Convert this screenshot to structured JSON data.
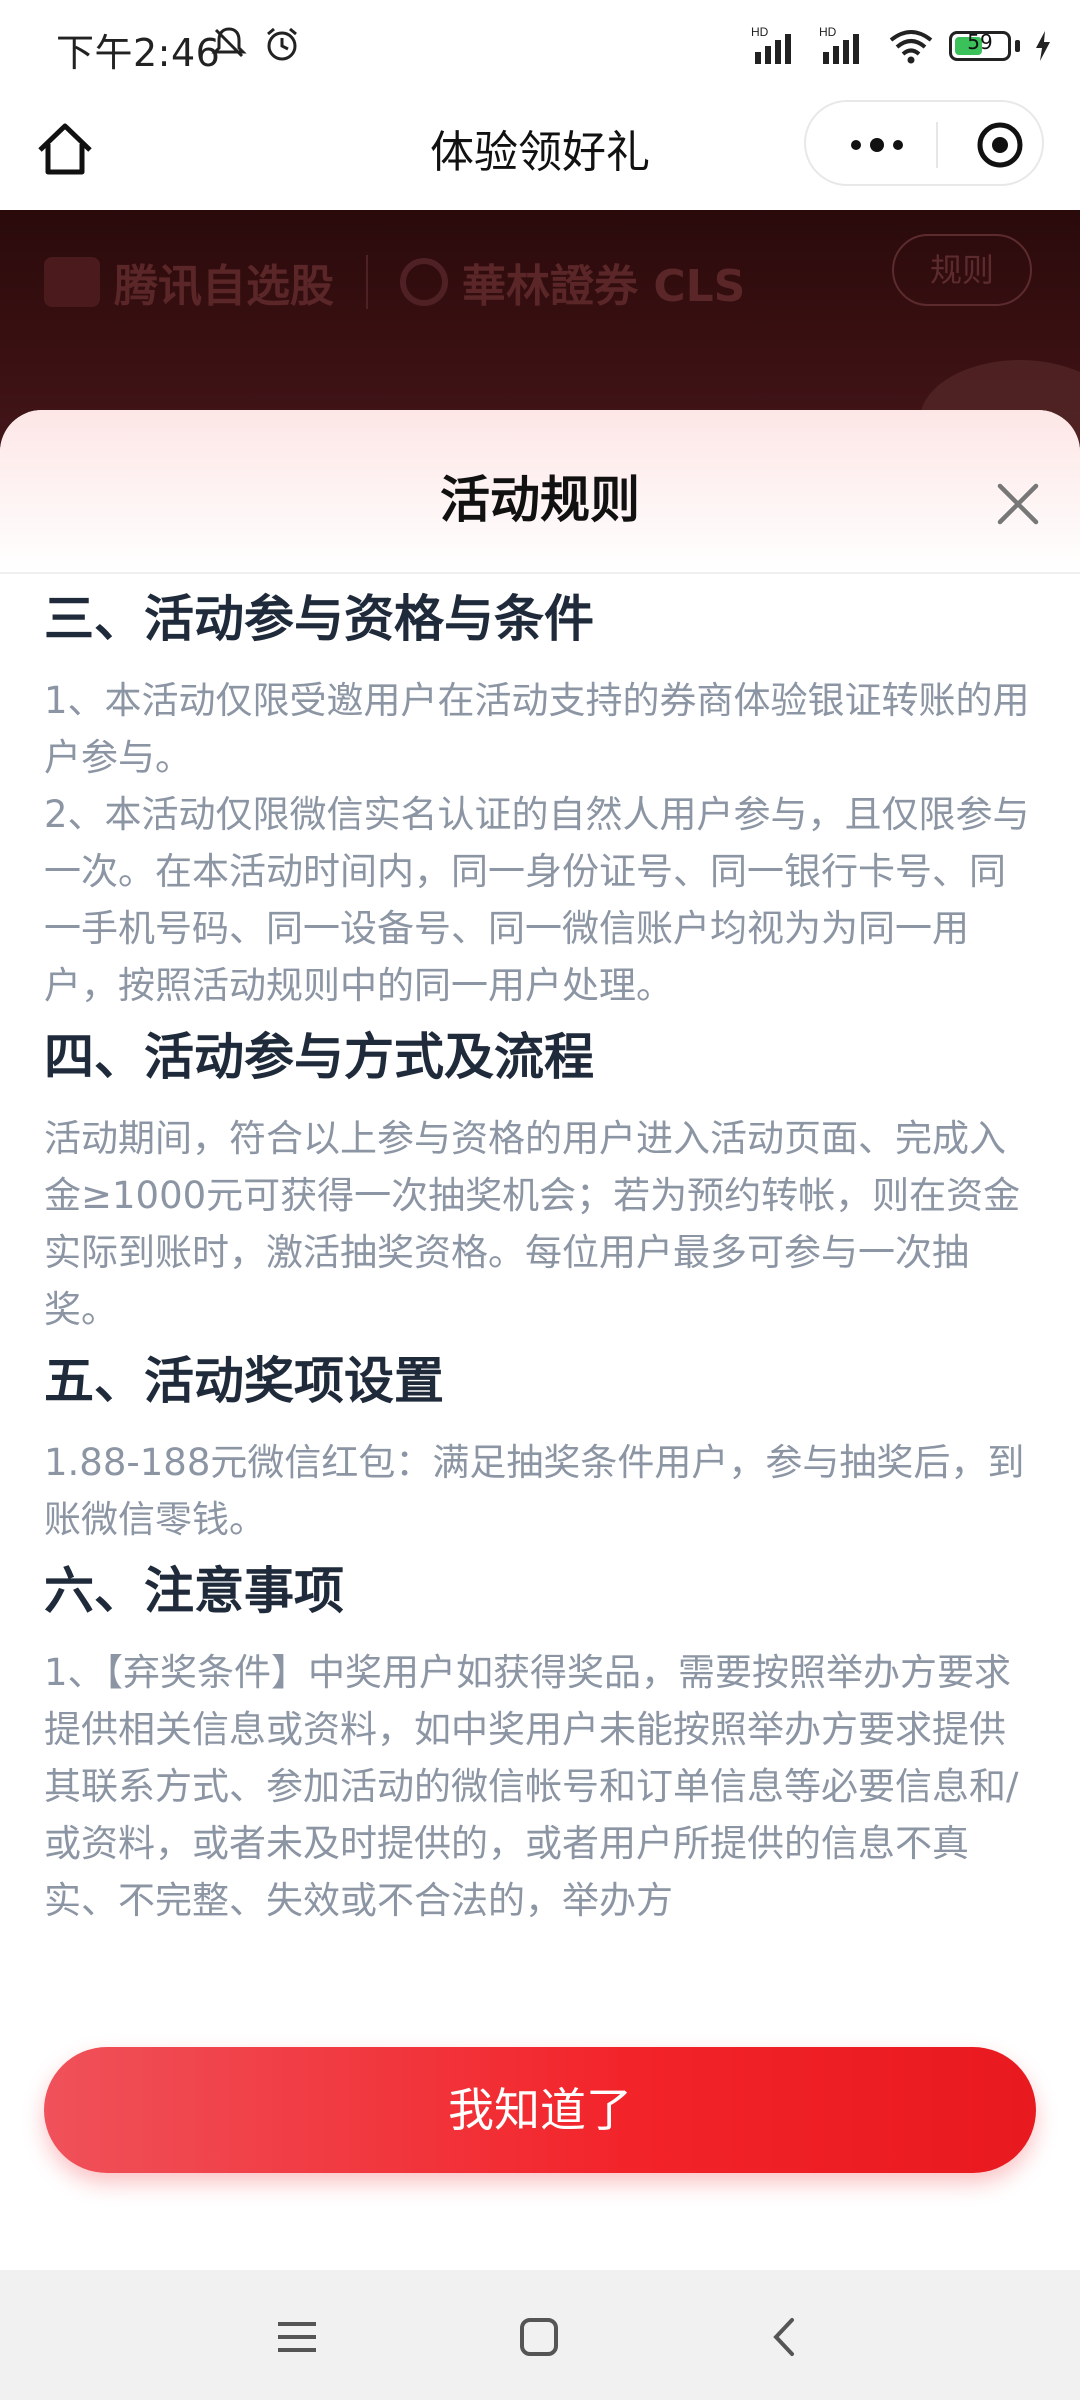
{
  "status_bar": {
    "time": "下午2:46",
    "battery_percent": "59",
    "battery_level": 0.59,
    "network": "HD"
  },
  "nav": {
    "title": "体验领好礼"
  },
  "banner": {
    "brand_1": "腾讯自选股",
    "brand_2": "華林證券 CLS",
    "rules_label": "规则"
  },
  "modal": {
    "title": "活动规则",
    "sections": [
      {
        "heading": "三、活动参与资格与条件",
        "paragraphs": [
          "1、本活动仅限受邀用户在活动支持的券商体验银证转账的用户参与。",
          "2、本活动仅限微信实名认证的自然人用户参与，且仅限参与一次。在本活动时间内，同一身份证号、同一银行卡号、同一手机号码、同一设备号、同一微信账户均视为为同一用户，按照活动规则中的同一用户处理。"
        ]
      },
      {
        "heading": "四、活动参与方式及流程",
        "paragraphs": [
          "活动期间，符合以上参与资格的用户进入活动页面、完成入金≥1000元可获得一次抽奖机会；若为预约转帐，则在资金实际到账时，激活抽奖资格。每位用户最多可参与一次抽奖。"
        ]
      },
      {
        "heading": "五、活动奖项设置",
        "paragraphs": [
          "1.88-188元微信红包：满足抽奖条件用户，参与抽奖后，到账微信零钱。"
        ]
      },
      {
        "heading": "六、注意事项",
        "paragraphs": [
          "1、【弃奖条件】中奖用户如获得奖品，需要按照举办方要求提供相关信息或资料，如中奖用户未能按照举办方要求提供其联系方式、参加活动的微信帐号和订单信息等必要信息和/或资料，或者未及时提供的，或者用户所提供的信息不真实、不完整、失效或不合法的，举办方"
        ]
      }
    ],
    "confirm_label": "我知道了"
  },
  "colors": {
    "accent": "#f22329",
    "heading": "#1f2a3a",
    "body_text": "#8c95a3",
    "banner_bg": "#3a1012"
  },
  "icons": {
    "home": "home-icon",
    "more": "more-dots-icon",
    "capsule_close": "target-circle-icon",
    "modal_close": "close-icon",
    "menu": "menu-icon",
    "android_home": "square-home-icon",
    "back": "back-chevron-icon"
  }
}
